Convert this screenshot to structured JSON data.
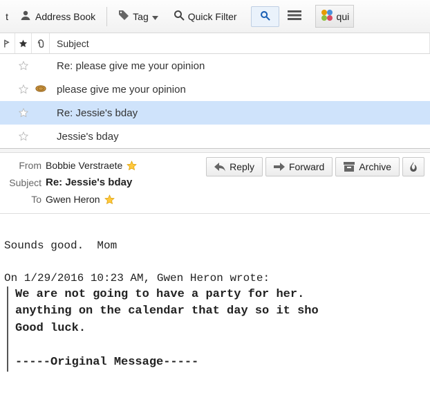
{
  "toolbar": {
    "item0_trunc": "t",
    "address_book": "Address Book",
    "tag": "Tag",
    "quick_filter": "Quick Filter",
    "addon_trunc": "qui"
  },
  "columns": {
    "subject": "Subject"
  },
  "messages": [
    {
      "has_attach": false,
      "subject": "Re: please give me your opinion"
    },
    {
      "has_attach": true,
      "subject": "please give me your opinion"
    },
    {
      "has_attach": false,
      "subject": "Re: Jessie's bday"
    },
    {
      "has_attach": false,
      "subject": "Jessie's bday"
    }
  ],
  "selected_index": 2,
  "header": {
    "from_label": "From",
    "from_value": "Bobbie Verstraete",
    "subject_label": "Subject",
    "subject_value": "Re: Jessie's bday",
    "to_label": "To",
    "to_value": "Gwen Heron",
    "reply": "Reply",
    "forward": "Forward",
    "archive": "Archive"
  },
  "body": {
    "line1": "Sounds good.  Mom",
    "context": "On 1/29/2016 10:23 AM, Gwen Heron wrote:",
    "q1": "We are not going to have a party for her.",
    "q2": "anything on the calendar that day so it sho",
    "q3": "Good luck.",
    "q4": "-----Original Message-----"
  }
}
